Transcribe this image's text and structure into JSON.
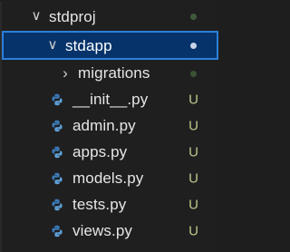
{
  "explorer": {
    "items": [
      {
        "label": "stdproj",
        "kind": "folder",
        "expanded": true,
        "decoration": "dot"
      },
      {
        "label": "stdapp",
        "kind": "folder",
        "expanded": true,
        "selected": true,
        "decoration": "dot"
      },
      {
        "label": "migrations",
        "kind": "folder",
        "expanded": false,
        "decoration": "dot"
      },
      {
        "label": "__init__.py",
        "kind": "file",
        "icon": "python-icon",
        "decoration": "U"
      },
      {
        "label": "admin.py",
        "kind": "file",
        "icon": "python-icon",
        "decoration": "U"
      },
      {
        "label": "apps.py",
        "kind": "file",
        "icon": "python-icon",
        "decoration": "U"
      },
      {
        "label": "models.py",
        "kind": "file",
        "icon": "python-icon",
        "decoration": "U"
      },
      {
        "label": "tests.py",
        "kind": "file",
        "icon": "python-icon",
        "decoration": "U"
      },
      {
        "label": "views.py",
        "kind": "file",
        "icon": "python-icon",
        "decoration": "U"
      }
    ]
  },
  "colors": {
    "background": "#1f1f20",
    "selection_bg": "#06336a",
    "selection_border": "#2b7fd9",
    "untracked_badge": "#b9c98a"
  }
}
